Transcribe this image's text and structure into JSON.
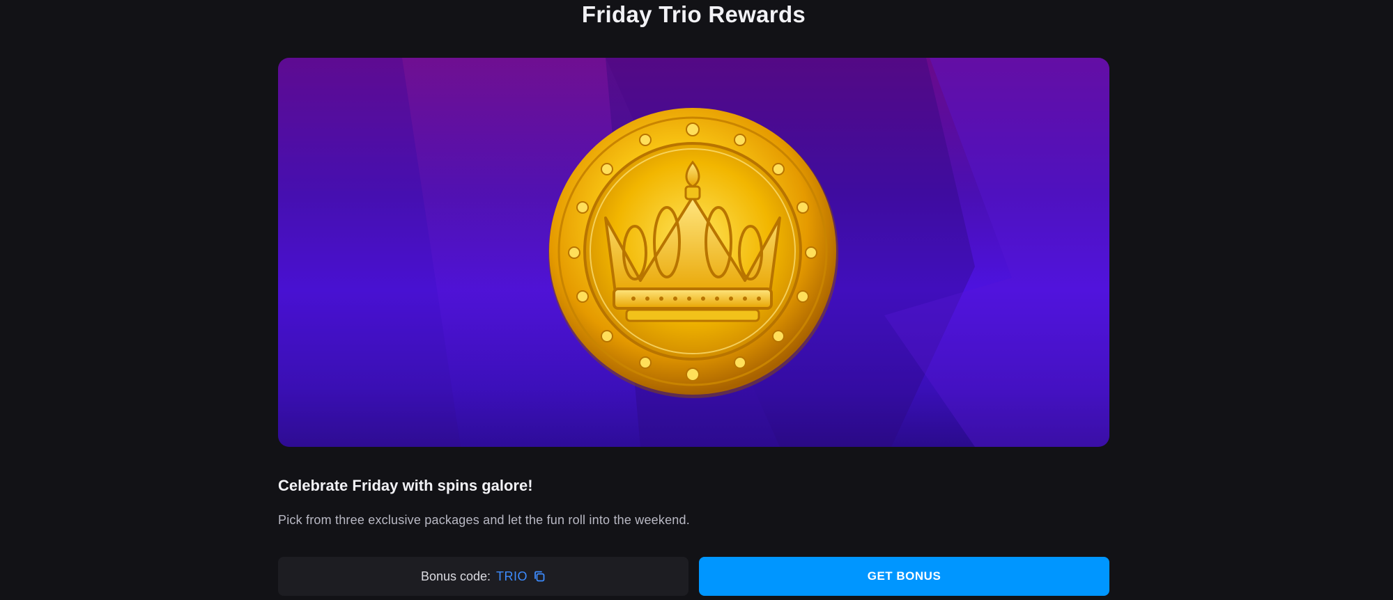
{
  "page": {
    "title": "Friday Trio Rewards"
  },
  "hero": {
    "image": "gold-crown-coin",
    "colors": {
      "top": "#6a0a8a",
      "middle": "#4d12e0",
      "bottom": "#2a0b8c",
      "coin_gold": "#f5b800"
    }
  },
  "promo": {
    "heading": "Celebrate Friday with spins galore!",
    "description": "Pick from three exclusive packages and let the fun roll into the weekend."
  },
  "bonus": {
    "code_label": "Bonus code:",
    "code_value": "TRIO",
    "copy_icon": "copy-icon",
    "button_label": "GET BONUS",
    "button_color": "#0096ff",
    "code_color": "#3d8cff"
  }
}
